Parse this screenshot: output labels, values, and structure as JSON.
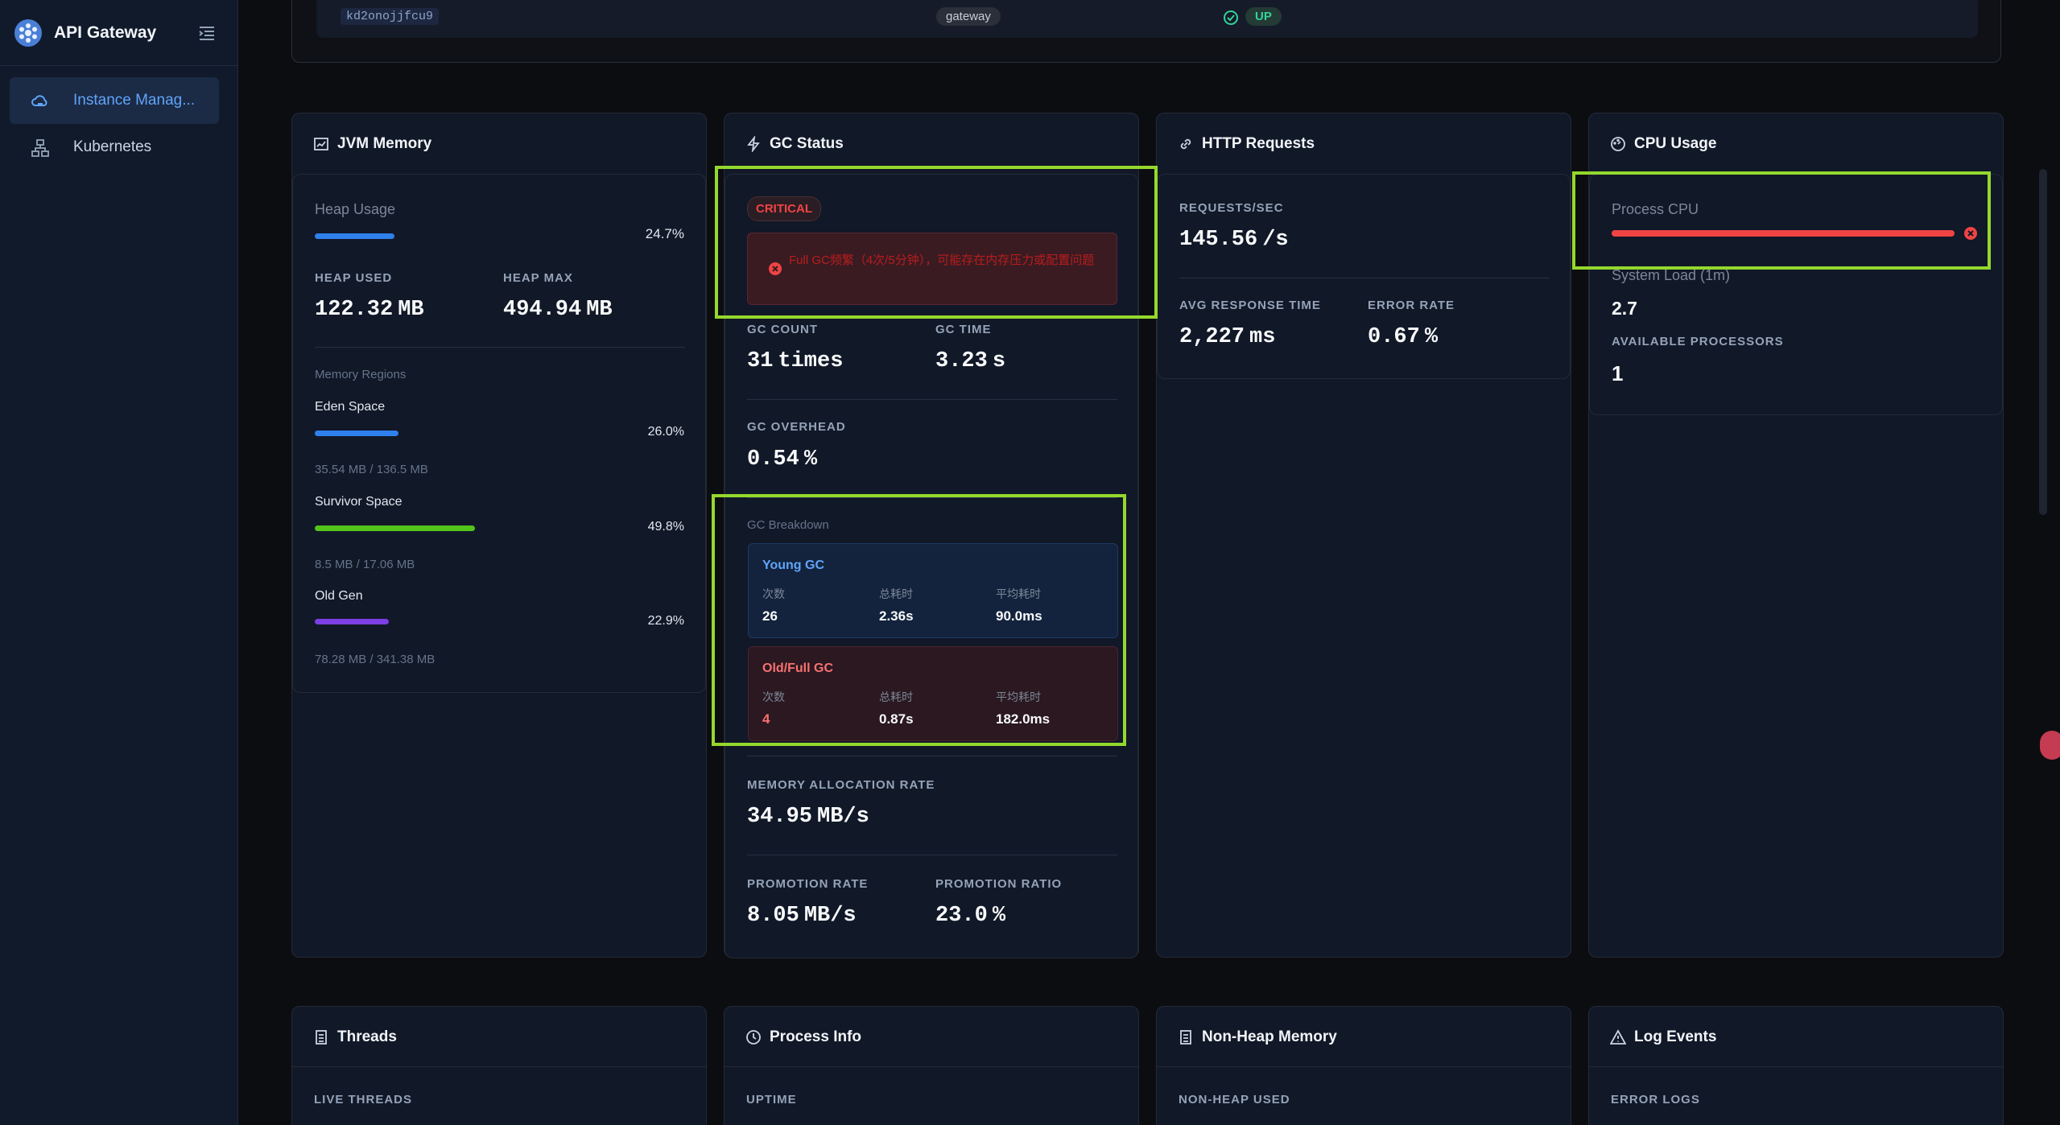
{
  "sidebar": {
    "brand": "API Gateway",
    "items": [
      {
        "label": "Instance Manag...",
        "active": true,
        "icon": "cloud-icon"
      },
      {
        "label": "Kubernetes",
        "active": false,
        "icon": "cluster-icon"
      }
    ]
  },
  "instance": {
    "id": "kd2onojjfcu9",
    "service": "gateway",
    "status": "UP"
  },
  "jvm": {
    "title": "JVM Memory",
    "heap_usage_label": "Heap Usage",
    "heap_usage_pct": "24.7%",
    "heap_usage_value": 24.7,
    "heap_used_label": "HEAP USED",
    "heap_used_value": "122.32",
    "heap_used_unit": "MB",
    "heap_max_label": "HEAP MAX",
    "heap_max_value": "494.94",
    "heap_max_unit": "MB",
    "regions_label": "Memory Regions",
    "regions": [
      {
        "name": "Eden Space",
        "pct": "26.0%",
        "value": 26.0,
        "detail": "35.54 MB / 136.5 MB",
        "color": "#2f80ed"
      },
      {
        "name": "Survivor Space",
        "pct": "49.8%",
        "value": 49.8,
        "detail": "8.5 MB / 17.06 MB",
        "color": "#52c41a"
      },
      {
        "name": "Old Gen",
        "pct": "22.9%",
        "value": 22.9,
        "detail": "78.28 MB / 341.38 MB",
        "color": "#7b3fe4"
      }
    ]
  },
  "gc": {
    "title": "GC Status",
    "badge": "CRITICAL",
    "alert": "Full GC频繁（4次/5分钟），可能存在内存压力或配置问题",
    "count_label": "GC COUNT",
    "count_value": "31",
    "count_unit": "times",
    "time_label": "GC TIME",
    "time_value": "3.23",
    "time_unit": "s",
    "overhead_label": "GC OVERHEAD",
    "overhead_value": "0.54",
    "overhead_unit": "%",
    "breakdown_label": "GC Breakdown",
    "young": {
      "title": "Young GC",
      "k1": "次数",
      "v1": "26",
      "k2": "总耗时",
      "v2": "2.36s",
      "k3": "平均耗时",
      "v3": "90.0ms"
    },
    "old": {
      "title": "Old/Full GC",
      "k1": "次数",
      "v1": "4",
      "k2": "总耗时",
      "v2": "0.87s",
      "k3": "平均耗时",
      "v3": "182.0ms"
    },
    "alloc_label": "MEMORY ALLOCATION RATE",
    "alloc_value": "34.95",
    "alloc_unit": "MB/s",
    "promo_rate_label": "PROMOTION RATE",
    "promo_rate_value": "8.05",
    "promo_rate_unit": "MB/s",
    "promo_ratio_label": "PROMOTION RATIO",
    "promo_ratio_value": "23.0",
    "promo_ratio_unit": "%"
  },
  "http": {
    "title": "HTTP Requests",
    "rps_label": "REQUESTS/SEC",
    "rps_value": "145.56",
    "rps_unit": "/s",
    "resp_label": "AVG RESPONSE TIME",
    "resp_value": "2,227",
    "resp_unit": "ms",
    "err_label": "ERROR RATE",
    "err_value": "0.67",
    "err_unit": "%"
  },
  "cpu": {
    "title": "CPU Usage",
    "process_label": "Process CPU",
    "process_value": 100,
    "load_label": "System Load (1m)",
    "load_value": "2.7",
    "proc_label": "AVAILABLE PROCESSORS",
    "proc_value": "1"
  },
  "bottom": {
    "threads_title": "Threads",
    "threads_label": "LIVE THREADS",
    "process_title": "Process Info",
    "process_label": "UPTIME",
    "nonheap_title": "Non-Heap Memory",
    "nonheap_label": "NON-HEAP USED",
    "log_title": "Log Events",
    "log_label": "ERROR LOGS"
  },
  "colors": {
    "accent": "#60a5fa",
    "critical": "#ef4444",
    "ok": "#34d399",
    "highlight": "#94d82d"
  }
}
